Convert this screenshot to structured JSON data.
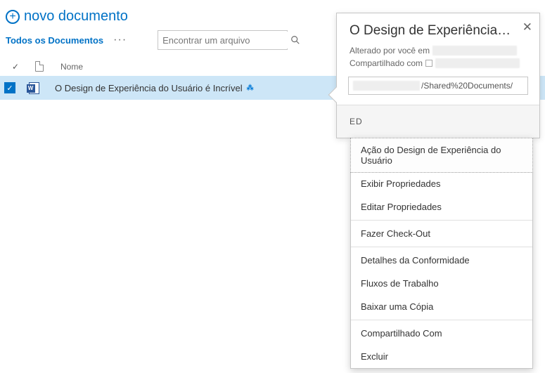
{
  "header": {
    "new_doc_label": "novo documento"
  },
  "toolbar": {
    "view_name": "Todos os Documentos",
    "search_placeholder": "Encontrar um arquivo"
  },
  "list": {
    "columns": {
      "name": "Nome"
    },
    "rows": [
      {
        "title": "O Design de Experiência do Usuário é Incrível",
        "selected": true,
        "is_new": true
      }
    ]
  },
  "callout": {
    "title": "O Design de Experiência do...",
    "modified_prefix": "Alterado por você em",
    "shared_prefix": "Compartilhado com",
    "url_suffix": "/Shared%20Documents/",
    "footer_fragment": "ED"
  },
  "menu": {
    "items": [
      "Ação do Design de Experiência do Usuário",
      "Exibir Propriedades",
      "Editar Propriedades",
      "Fazer Check-Out",
      "Detalhes da Conformidade",
      "Fluxos de Trabalho",
      "Baixar uma Cópia",
      "Compartilhado Com",
      "Excluir"
    ]
  }
}
